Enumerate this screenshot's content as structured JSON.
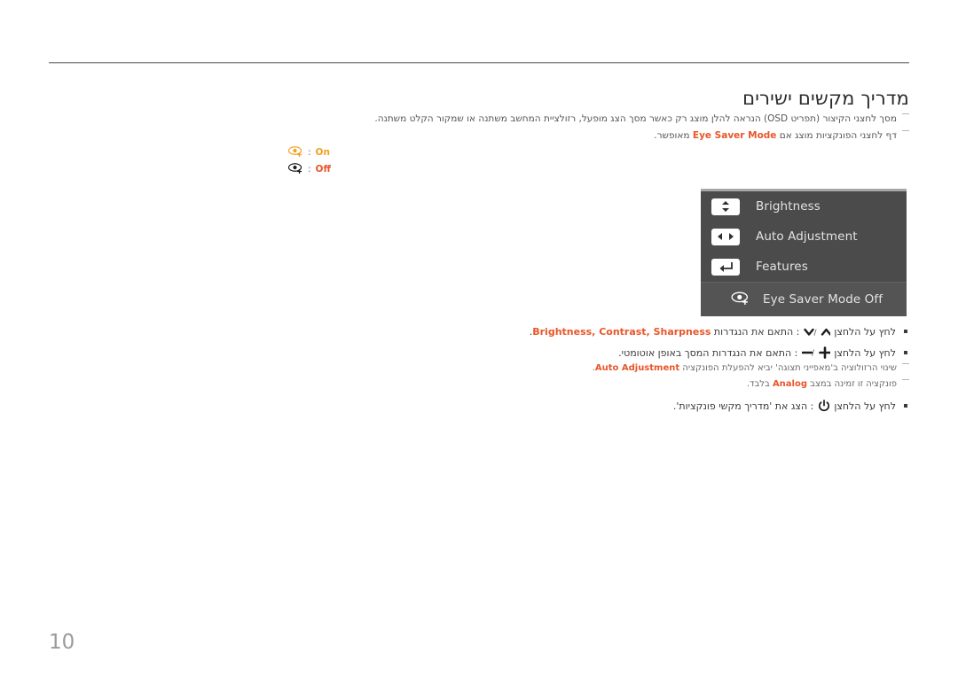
{
  "document": {
    "title": "מדריך מקשים ישירים",
    "page_number": "10"
  },
  "notes": [
    {
      "text": "מסך לחצני הקיצור (תפריט OSD) הנראה להלן מוצג רק כאשר מסך הצג מופעל, רזולציית המחשב משתנה או שמקור הקלט משתנה."
    },
    {
      "prefix": "דף לחצני הפונקציות מוצג אם ",
      "highlight": "Eye Saver Mode",
      "suffix": " מאופשר."
    }
  ],
  "eye_states": [
    {
      "label": "On",
      "color": "#f2a01e"
    },
    {
      "label": "Off",
      "color": "#e8562a"
    }
  ],
  "osd": {
    "items": [
      {
        "icon": "updown-arrows-icon",
        "label": "Brightness"
      },
      {
        "icon": "leftright-arrows-icon",
        "label": "Auto Adjustment"
      },
      {
        "icon": "enter-return-icon",
        "label": "Features"
      }
    ],
    "footer": {
      "icon": "eye-saver-icon",
      "label": "Eye Saver Mode Off"
    }
  },
  "bullets": [
    {
      "prefix": "לחץ על הלחצן ",
      "keys": "∨ / ∧",
      "middle": " : התאם את הנגדרות ",
      "highlight": "Brightness, Contrast, Sharpness",
      "suffix": "."
    },
    {
      "prefix": "לחץ על הלחצן ",
      "keys": "— / +",
      "middle": " : התאם את הנגדרות המסך באופן אוטומטי.",
      "highlight": "",
      "suffix": ""
    }
  ],
  "sub_notes": [
    {
      "prefix": "שינוי הרזולוציה ב'מאפייני תצוגה' יביא להפעלת הפונקציה ",
      "highlight": "Auto Adjustment",
      "suffix": "."
    },
    {
      "prefix": "פונקציה זו זמינה במצב ",
      "highlight": "Analog",
      "suffix": " בלבד."
    }
  ],
  "bullet_last": {
    "prefix": "לחץ על הלחצן ",
    "keys": "⏻",
    "middle": " : הצג את 'מדריך מקשי פונקציות'.",
    "highlight": "",
    "suffix": ""
  },
  "colors": {
    "accent_orange": "#e8562a",
    "accent_yellow": "#f2a01e",
    "osd_background": "#4b4b4b",
    "osd_footer_background": "#545454",
    "osd_top_border": "#a6a6a6",
    "rule": "#8a8a8a",
    "page_number": "#9a9a9a"
  }
}
